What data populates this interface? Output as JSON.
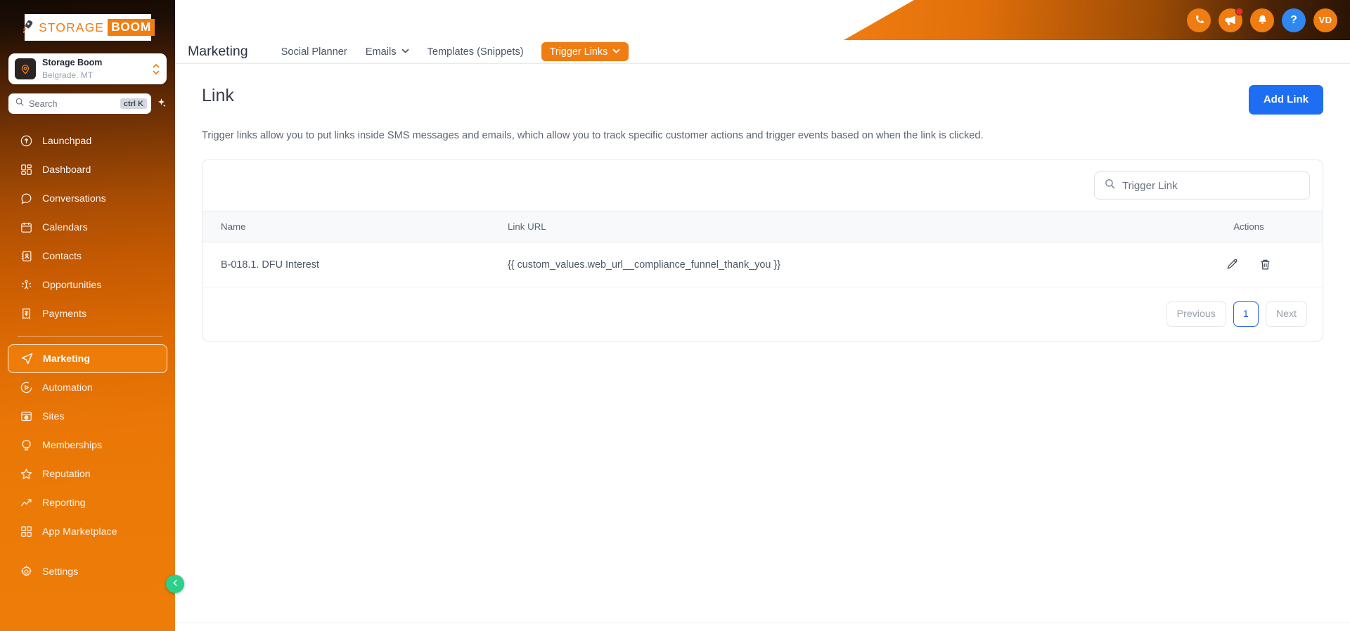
{
  "brand": {
    "logo_rocket_icon": "rocket-icon",
    "logo_word_1": "STORAGE",
    "logo_word_2": "BOOM",
    "accent_orange": "#f07d12",
    "accent_blue": "#1d6ef2",
    "collapse_green": "#2dd08a"
  },
  "sidebar": {
    "location": {
      "name": "Storage Boom",
      "sub": "Belgrade, MT",
      "avatar_icon": "location-pin-icon",
      "switcher_icon": "chevron-up-down-icon"
    },
    "search": {
      "placeholder": "Search",
      "shortcut": "ctrl K",
      "icon": "search-icon",
      "ai_icon": "sparkle-icon"
    },
    "items": [
      {
        "label": "Launchpad",
        "icon": "rocket-launch-icon",
        "active": false
      },
      {
        "label": "Dashboard",
        "icon": "dashboard-grid-icon",
        "active": false
      },
      {
        "label": "Conversations",
        "icon": "chat-bubble-icon",
        "active": false
      },
      {
        "label": "Calendars",
        "icon": "calendar-icon",
        "active": false
      },
      {
        "label": "Contacts",
        "icon": "contacts-book-icon",
        "active": false
      },
      {
        "label": "Opportunities",
        "icon": "opportunities-icon",
        "active": false
      },
      {
        "label": "Payments",
        "icon": "payments-receipt-icon",
        "active": false
      },
      {
        "label": "Marketing",
        "icon": "paper-plane-icon",
        "active": true
      },
      {
        "label": "Automation",
        "icon": "play-circle-icon",
        "active": false
      },
      {
        "label": "Sites",
        "icon": "sites-window-icon",
        "active": false
      },
      {
        "label": "Memberships",
        "icon": "award-ribbon-icon",
        "active": false
      },
      {
        "label": "Reputation",
        "icon": "star-icon",
        "active": false
      },
      {
        "label": "Reporting",
        "icon": "trend-up-icon",
        "active": false
      },
      {
        "label": "App Marketplace",
        "icon": "apps-grid-icon",
        "active": false
      },
      {
        "label": "Settings",
        "icon": "gear-icon",
        "active": false
      }
    ],
    "collapse_icon": "chevron-left-icon"
  },
  "topbar": {
    "icons": [
      {
        "name": "phone-icon",
        "glyph": "phone",
        "style": "orange",
        "badge": false
      },
      {
        "name": "megaphone-icon",
        "glyph": "megaphone",
        "style": "orange",
        "badge": true
      },
      {
        "name": "bell-icon",
        "glyph": "bell",
        "style": "orange",
        "badge": false
      },
      {
        "name": "help-icon",
        "glyph": "?",
        "style": "blue",
        "badge": false
      }
    ],
    "avatar_initials": "VD"
  },
  "tabs": {
    "title": "Marketing",
    "items": [
      {
        "label": "Social Planner",
        "caret": false,
        "active": false
      },
      {
        "label": "Emails",
        "caret": true,
        "active": false
      },
      {
        "label": "Templates (Snippets)",
        "caret": false,
        "active": false
      },
      {
        "label": "Trigger Links",
        "caret": true,
        "active": true
      }
    ],
    "caret_icon": "chevron-down-icon"
  },
  "main": {
    "page_title": "Link",
    "add_link_label": "Add Link",
    "description": "Trigger links allow you to put links inside SMS messages and emails, which allow you to track specific customer actions and trigger events based on when the link is clicked.",
    "table_search": {
      "placeholder": "Trigger Link",
      "icon": "search-icon"
    },
    "table": {
      "columns": [
        "Name",
        "Link URL",
        "Actions"
      ],
      "rows": [
        {
          "name": "B-018.1. DFU Interest",
          "url": "{{ custom_values.web_url__compliance_funnel_thank_you }}",
          "edit_icon": "pencil-icon",
          "delete_icon": "trash-icon"
        }
      ]
    },
    "pagination": {
      "previous": "Previous",
      "pages": [
        "1"
      ],
      "next": "Next",
      "current": "1"
    }
  }
}
